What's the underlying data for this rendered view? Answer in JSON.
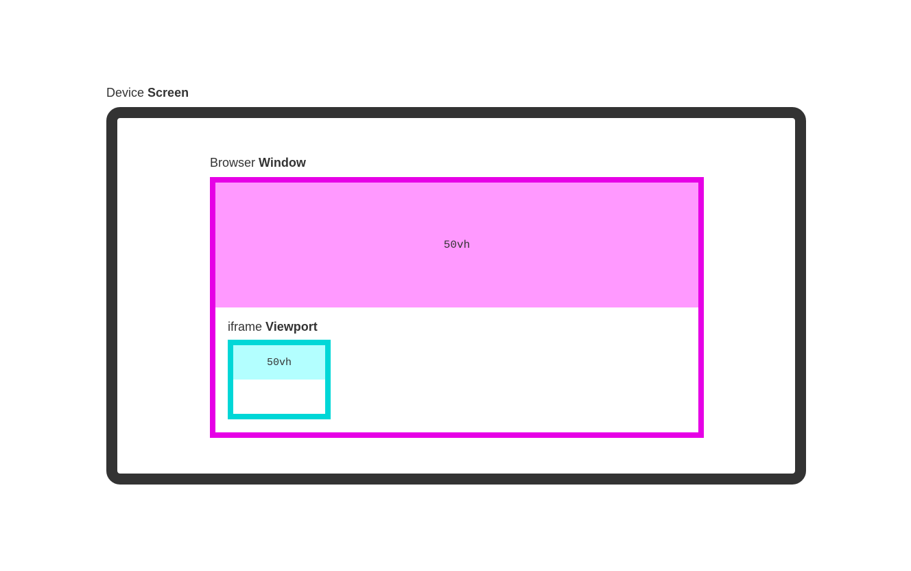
{
  "screen": {
    "label_prefix": "Device ",
    "label_bold": "Screen",
    "colors": {
      "border": "#333333"
    }
  },
  "window": {
    "label_prefix": "Browser ",
    "label_bold": "Window",
    "upper_text": "50vh",
    "colors": {
      "border": "#e600e6",
      "fill": "#ff99ff"
    }
  },
  "viewport": {
    "label_prefix": "iframe ",
    "label_bold": "Viewport",
    "upper_text": "50vh",
    "colors": {
      "border": "#00d7d7",
      "fill": "#b3ffff"
    }
  }
}
